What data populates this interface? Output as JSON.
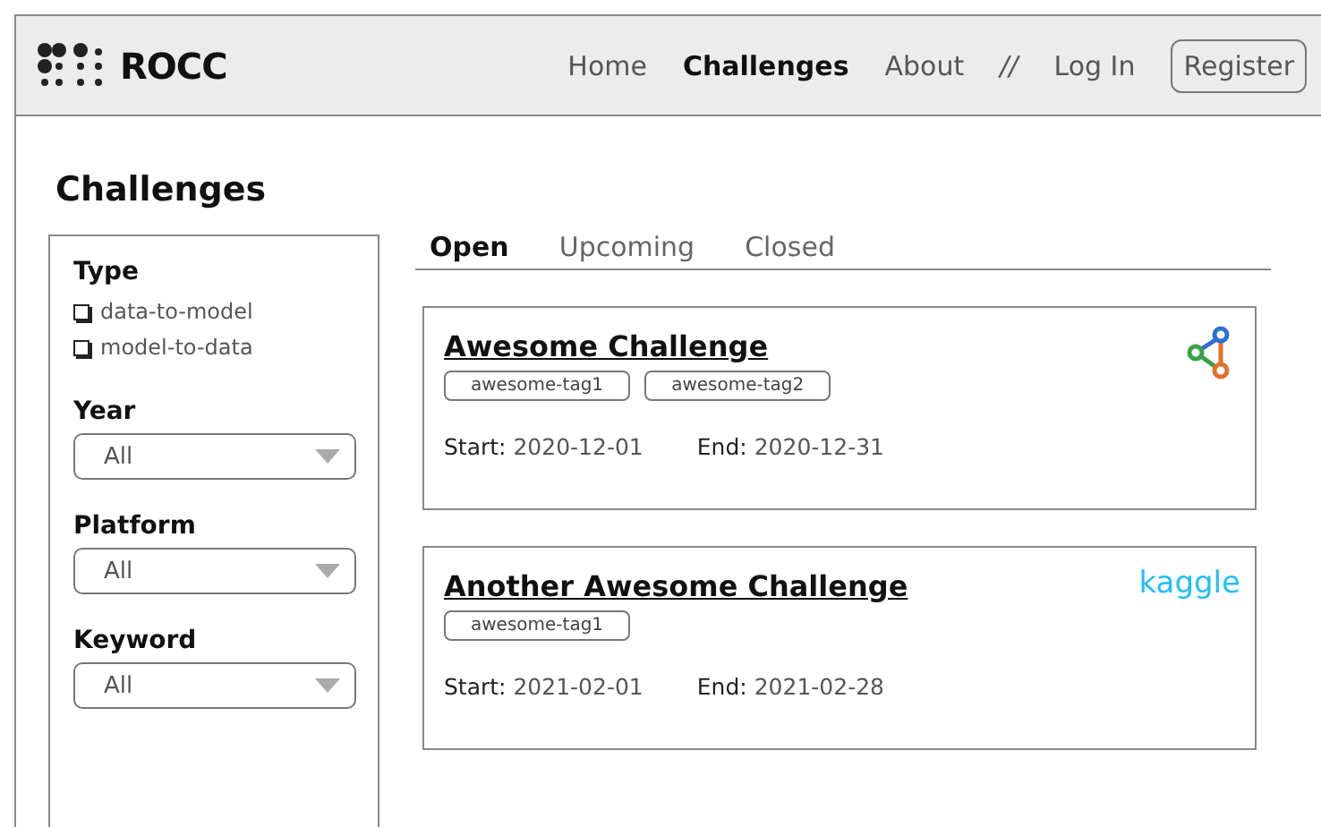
{
  "header": {
    "logo": "ROCC",
    "nav": [
      {
        "label": "Home",
        "selected": false
      },
      {
        "label": "Challenges",
        "selected": true
      },
      {
        "label": "About",
        "selected": false
      }
    ],
    "separator": "//",
    "login": "Log In",
    "register": "Register"
  },
  "page_title": "Challenges",
  "filters": {
    "type": {
      "label": "Type",
      "options": [
        {
          "label": "data-to-model",
          "checked": false
        },
        {
          "label": "model-to-data",
          "checked": false
        }
      ]
    },
    "selects": [
      {
        "label": "Year",
        "value": "All"
      },
      {
        "label": "Platform",
        "value": "All"
      },
      {
        "label": "Keyword",
        "value": "All"
      }
    ]
  },
  "tabs": [
    {
      "label": "Open",
      "selected": true
    },
    {
      "label": "Upcoming",
      "selected": false
    },
    {
      "label": "Closed",
      "selected": false
    }
  ],
  "challenges": [
    {
      "title": "Awesome Challenge",
      "tags": [
        "awesome-tag1",
        "awesome-tag2"
      ],
      "start_label": "Start:",
      "start": "2020-12-01",
      "end_label": "End:",
      "end": "2020-12-31",
      "platform": {
        "kind": "graph-icon"
      }
    },
    {
      "title": "Another Awesome Challenge",
      "tags": [
        "awesome-tag1"
      ],
      "start_label": "Start:",
      "start": "2021-02-01",
      "end_label": "End:",
      "end": "2021-02-28",
      "platform": {
        "kind": "wordmark",
        "text": "kaggle"
      }
    }
  ]
}
